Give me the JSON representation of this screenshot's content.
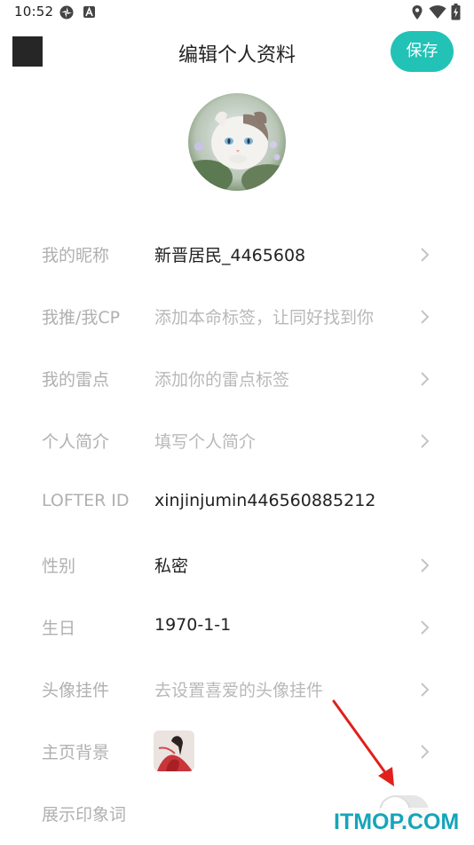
{
  "status_bar": {
    "time": "10:52",
    "icons": [
      "sync-icon",
      "a-notification-icon",
      "location-icon",
      "wifi-icon",
      "battery-icon"
    ]
  },
  "header": {
    "title": "编辑个人资料",
    "save_label": "保存",
    "accent_color": "#22c2b6"
  },
  "profile": {
    "avatar": "cat-avatar-image"
  },
  "rows": [
    {
      "label": "我的昵称",
      "value": "新晋居民_4465608",
      "placeholder": false,
      "arrow": true
    },
    {
      "label": "我推/我CP",
      "value": "添加本命标签，让同好找到你",
      "placeholder": true,
      "arrow": true
    },
    {
      "label": "我的雷点",
      "value": "添加你的雷点标签",
      "placeholder": true,
      "arrow": true
    },
    {
      "label": "个人简介",
      "value": "填写个人简介",
      "placeholder": true,
      "arrow": true
    },
    {
      "label": "LOFTER ID",
      "value": "xinjinjumin446560885212",
      "placeholder": false,
      "arrow": false
    },
    {
      "label": "性别",
      "value": "私密",
      "placeholder": false,
      "arrow": true
    },
    {
      "label": "生日",
      "value": "1970-1-1",
      "placeholder": false,
      "arrow": true
    },
    {
      "label": "头像挂件",
      "value": "去设置喜爱的头像挂件",
      "placeholder": true,
      "arrow": true
    },
    {
      "label": "主页背景",
      "value": "",
      "placeholder": false,
      "arrow": true
    },
    {
      "label": "展示印象词",
      "value": "",
      "placeholder": false,
      "arrow": false
    }
  ],
  "impression_toggle": {
    "on": false
  },
  "watermark": "ITMOP.COM"
}
